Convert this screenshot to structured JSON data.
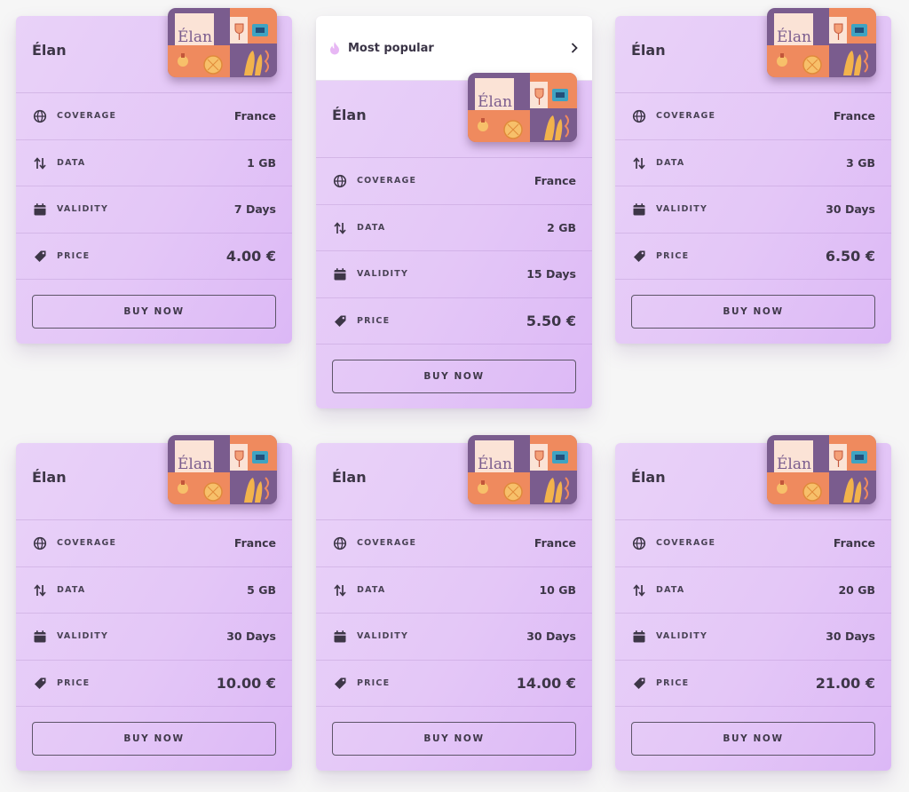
{
  "popular_badge": "Most popular",
  "cards": [
    {
      "brand": "Élan",
      "popular": false,
      "coverage_label": "COVERAGE",
      "coverage": "France",
      "data_label": "DATA",
      "data": "1 GB",
      "validity_label": "VALIDITY",
      "validity": "7 Days",
      "price_label": "PRICE",
      "price": "4.00 €",
      "button": "BUY NOW"
    },
    {
      "brand": "Élan",
      "popular": true,
      "coverage_label": "COVERAGE",
      "coverage": "France",
      "data_label": "DATA",
      "data": "2 GB",
      "validity_label": "VALIDITY",
      "validity": "15 Days",
      "price_label": "PRICE",
      "price": "5.50 €",
      "button": "BUY NOW"
    },
    {
      "brand": "Élan",
      "popular": false,
      "coverage_label": "COVERAGE",
      "coverage": "France",
      "data_label": "DATA",
      "data": "3 GB",
      "validity_label": "VALIDITY",
      "validity": "30 Days",
      "price_label": "PRICE",
      "price": "6.50 €",
      "button": "BUY NOW"
    },
    {
      "brand": "Élan",
      "popular": false,
      "coverage_label": "COVERAGE",
      "coverage": "France",
      "data_label": "DATA",
      "data": "5 GB",
      "validity_label": "VALIDITY",
      "validity": "30 Days",
      "price_label": "PRICE",
      "price": "10.00 €",
      "button": "BUY NOW"
    },
    {
      "brand": "Élan",
      "popular": false,
      "coverage_label": "COVERAGE",
      "coverage": "France",
      "data_label": "DATA",
      "data": "10 GB",
      "validity_label": "VALIDITY",
      "validity": "30 Days",
      "price_label": "PRICE",
      "price": "14.00 €",
      "button": "BUY NOW"
    },
    {
      "brand": "Élan",
      "popular": false,
      "coverage_label": "COVERAGE",
      "coverage": "France",
      "data_label": "DATA",
      "data": "20 GB",
      "validity_label": "VALIDITY",
      "validity": "30 Days",
      "price_label": "PRICE",
      "price": "21.00 €",
      "button": "BUY NOW"
    }
  ],
  "icons": {
    "coverage": "globe-icon",
    "data": "up-down-arrows-icon",
    "validity": "calendar-icon",
    "price": "price-tag-icon",
    "popular": "flame-icon",
    "chevron": "chevron-right-icon"
  },
  "colors": {
    "card_start": "#e9d2f8",
    "card_end": "#dcb8f6",
    "text": "#3d3647",
    "button_border": "#5d5568",
    "flame": "#e7b7f4"
  }
}
